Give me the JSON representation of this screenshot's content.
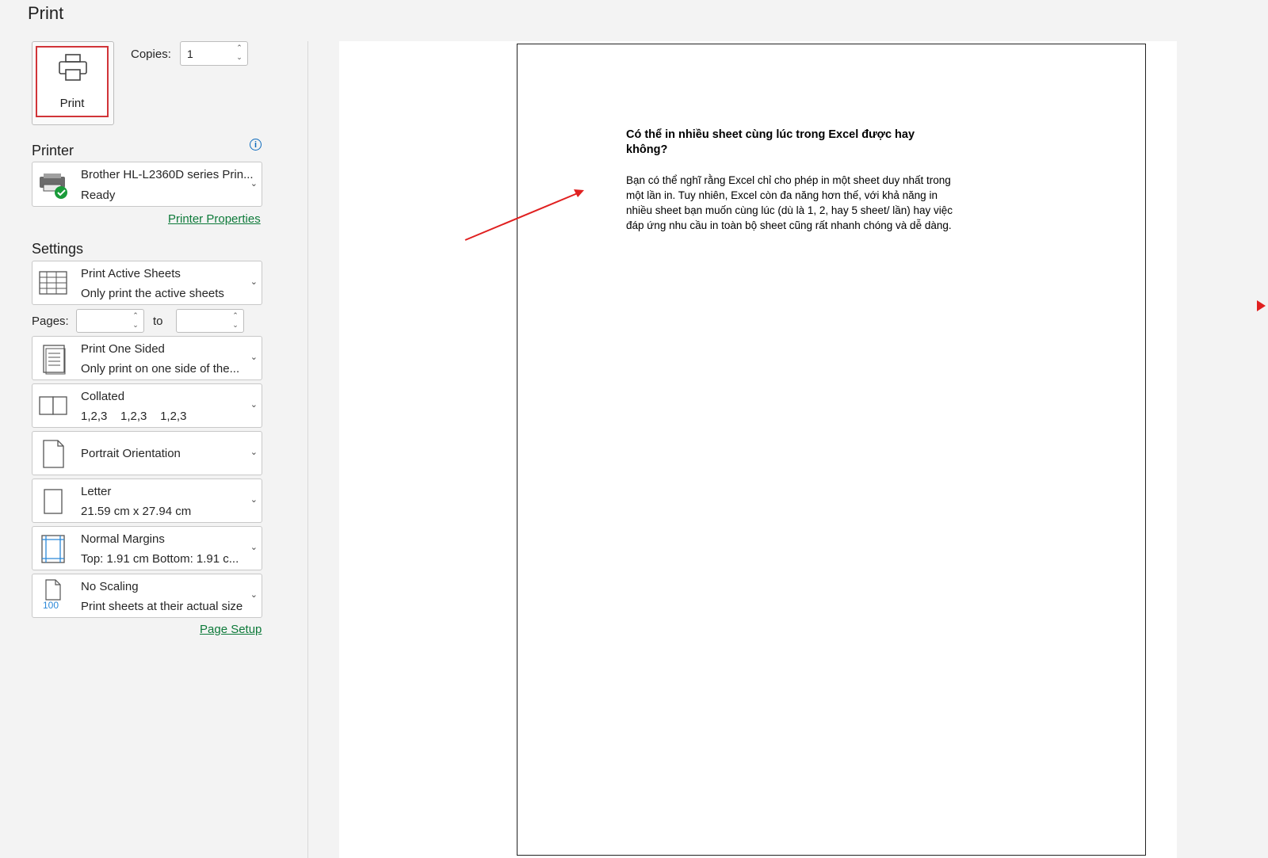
{
  "page": {
    "title": "Print"
  },
  "print_button": {
    "label": "Print"
  },
  "copies": {
    "label": "Copies:",
    "value": "1"
  },
  "printer": {
    "heading": "Printer",
    "name": "Brother HL-L2360D series Prin...",
    "status": "Ready",
    "properties_link": "Printer Properties"
  },
  "settings": {
    "heading": "Settings",
    "active_sheets": {
      "title": "Print Active Sheets",
      "subtitle": "Only print the active sheets"
    },
    "pages": {
      "label": "Pages:",
      "to_label": "to",
      "from_value": "",
      "to_value": ""
    },
    "sided": {
      "title": "Print One Sided",
      "subtitle": "Only print on one side of the..."
    },
    "collated": {
      "title": "Collated",
      "subtitle": "1,2,3    1,2,3    1,2,3"
    },
    "orientation": {
      "title": "Portrait Orientation"
    },
    "paper_size": {
      "title": "Letter",
      "subtitle": "21.59 cm x 27.94 cm"
    },
    "margins": {
      "title": "Normal Margins",
      "subtitle": "Top: 1.91 cm Bottom: 1.91 c..."
    },
    "scaling": {
      "title": "No Scaling",
      "subtitle": "Print sheets at their actual size",
      "icon_text": "100"
    },
    "page_setup_link": "Page Setup"
  },
  "preview": {
    "heading": "Có thể in nhiều sheet cùng lúc trong Excel được hay không?",
    "body": "Bạn có thể nghĩ rằng Excel chỉ cho phép in một sheet duy nhất trong một lần in. Tuy nhiên, Excel còn đa năng hơn thế, với khả năng in nhiều sheet bạn muốn cùng lúc (dù là 1, 2, hay 5 sheet/ lần) hay việc đáp ứng nhu cầu in toàn bộ sheet cũng rất nhanh chóng và dễ dàng."
  },
  "colors": {
    "accent_red": "#d13438",
    "link_green": "#0e7a3a",
    "info_blue": "#0f6cbd",
    "annotation_red": "#e02020"
  },
  "icons": {
    "print": "printer-icon",
    "printer_device": "printer-ready-icon",
    "info": "info-icon",
    "sheets": "sheets-grid-icon",
    "one_sided": "one-sided-page-icon",
    "collated": "collated-icon",
    "orientation": "portrait-page-icon",
    "paper": "paper-size-icon",
    "margins": "margins-icon",
    "scaling": "scaling-icon",
    "dropdown": "chevron-down-icon"
  }
}
